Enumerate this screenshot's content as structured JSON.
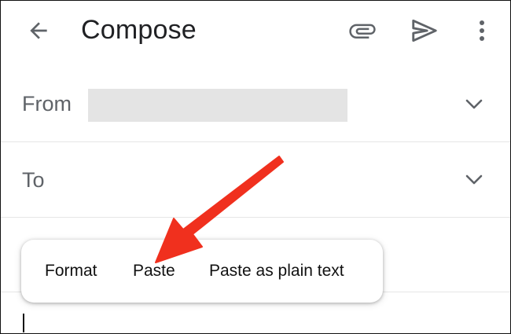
{
  "appbar": {
    "title": "Compose",
    "back_icon": "arrow-back-icon",
    "attach_icon": "paperclip-icon",
    "send_icon": "send-icon",
    "more_icon": "more-vert-icon"
  },
  "from": {
    "label": "From",
    "value": ""
  },
  "to": {
    "label": "To"
  },
  "context_menu": {
    "items": [
      "Format",
      "Paste",
      "Paste as plain text"
    ]
  },
  "annotation": {
    "color": "#f0301e"
  },
  "colors": {
    "icon": "#5f6368",
    "text": "#202124",
    "divider": "#e6e6e6",
    "redacted": "#e4e4e4"
  }
}
